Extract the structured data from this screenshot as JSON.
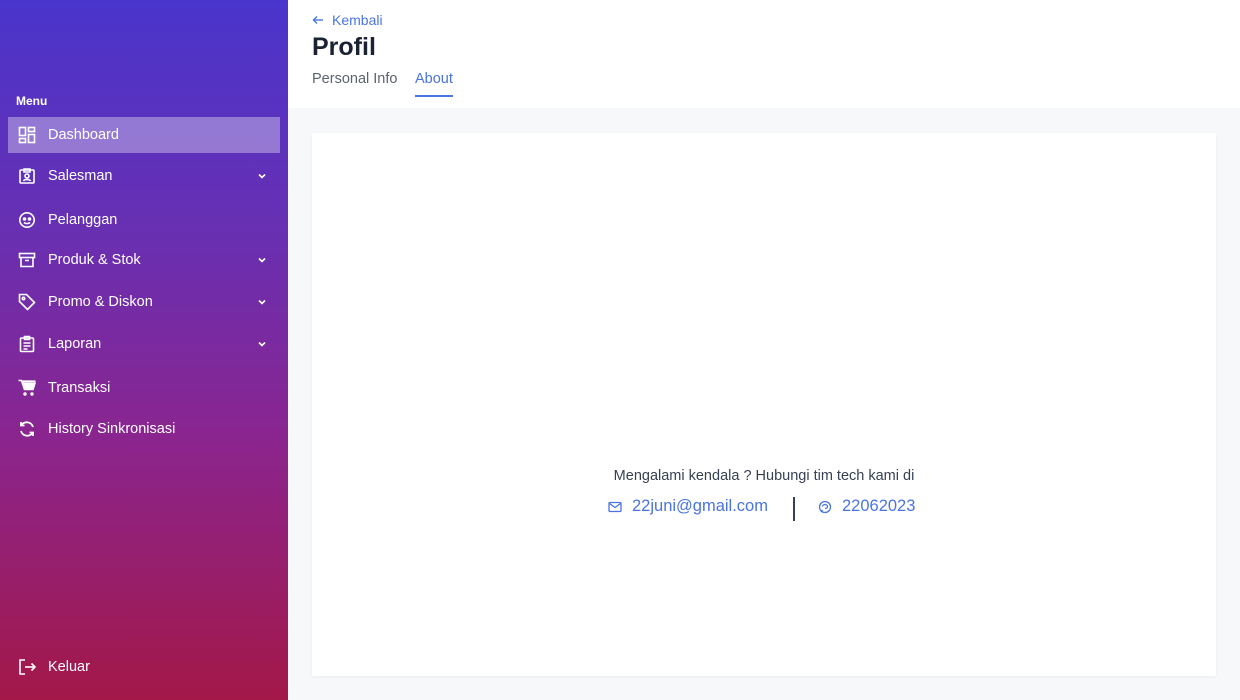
{
  "sidebar": {
    "menu_heading": "Menu",
    "items": [
      {
        "label": "Dashboard",
        "icon": "dashboard-icon",
        "active": true
      },
      {
        "label": "Salesman",
        "icon": "badge-icon",
        "has_submenu": true
      },
      {
        "label": "Pelanggan",
        "icon": "face-icon"
      },
      {
        "label": "Produk & Stok",
        "icon": "archive-icon",
        "has_submenu": true
      },
      {
        "label": "Promo & Diskon",
        "icon": "tag-icon",
        "has_submenu": true
      },
      {
        "label": "Laporan",
        "icon": "clipboard-icon",
        "has_submenu": true
      },
      {
        "label": "Transaksi",
        "icon": "cart-icon"
      },
      {
        "label": "History Sinkronisasi",
        "icon": "sync-icon"
      }
    ],
    "logout_label": "Keluar",
    "gradient": [
      "#4a35cc",
      "#a31848"
    ]
  },
  "header": {
    "back_label": "Kembali",
    "title": "Profil",
    "tabs": [
      {
        "label": "Personal Info",
        "active": false
      },
      {
        "label": "About",
        "active": true
      }
    ]
  },
  "about": {
    "contact_text": "Mengalami kendala ? Hubungi tim tech kami di",
    "email": "22juni@gmail.com",
    "phone": "22062023"
  },
  "colors": {
    "accent": "#4a74e0",
    "title": "#1a2233",
    "background": "#f7f8fa"
  }
}
